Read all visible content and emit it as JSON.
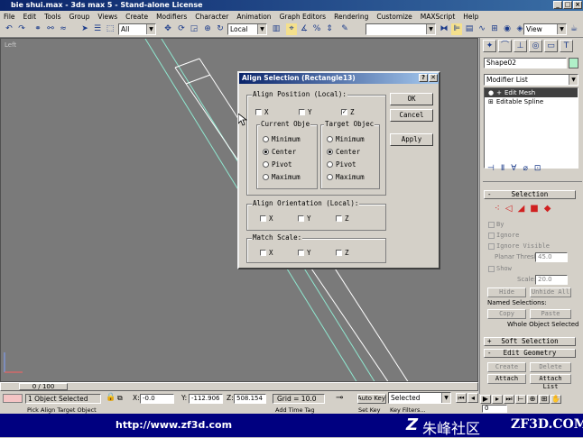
{
  "window": {
    "title": "bie shui.max - 3ds max 5 - Stand-alone License"
  },
  "menu": [
    "File",
    "Edit",
    "Tools",
    "Group",
    "Views",
    "Create",
    "Modifiers",
    "Character",
    "Animation",
    "Graph Editors",
    "Rendering",
    "Customize",
    "MAXScript",
    "Help"
  ],
  "toolbar": {
    "selection_filter": "All",
    "coord_system": "Local",
    "named_selection": "",
    "view_dropdown": "View"
  },
  "viewport": {
    "label": "Left"
  },
  "dialog": {
    "title": "Align Selection (Rectangle13)",
    "help_btn": "?",
    "close_btn": "✕",
    "align_position_label": "Align Position (Local):",
    "pos_x": "X",
    "pos_y": "Y",
    "pos_z": "Z",
    "pos_z_checked": true,
    "current_object_label": "Current Obje",
    "target_object_label": "Target Objec",
    "current_options": [
      "Minimum",
      "Center",
      "Pivot",
      "Maximum"
    ],
    "current_selected": 1,
    "target_options": [
      "Minimum",
      "Center",
      "Pivot",
      "Maximum"
    ],
    "target_selected": 1,
    "align_orientation_label": "Align Orientation (Local):",
    "ori_x": "X",
    "ori_y": "Y",
    "ori_z": "Z",
    "match_scale_label": "Match Scale:",
    "scale_x": "X",
    "scale_y": "Y",
    "scale_z": "Z",
    "ok": "OK",
    "cancel": "Cancel",
    "apply": "Apply"
  },
  "command_panel": {
    "object_name": "Shape02",
    "modifier_list": "Modifier List",
    "stack": [
      "Edit Mesh",
      "Editable Spline"
    ],
    "selection_rollout": "Selection",
    "by": "By",
    "ignore": "Ignore",
    "ignore_visible": "Ignore Visible",
    "planar_thresh_label": "Planar Thresh:",
    "planar_thresh": "45.0",
    "show": "Show",
    "scale_label": "Scale:",
    "scale": "20.0",
    "hide": "Hide",
    "unhide_all": "Unhide All",
    "named_selections": "Named Selections:",
    "copy": "Copy",
    "paste": "Paste",
    "whole_object_selected": "Whole Object Selected",
    "soft_selection": "Soft Selection",
    "edit_geometry": "Edit Geometry",
    "create": "Create",
    "delete": "Delete",
    "attach": "Attach",
    "attach_list": "Attach List"
  },
  "status": {
    "time_slider": "0 / 100",
    "selection_count": "1 Object Selected",
    "x_label": "X:",
    "x_value": "-0.0",
    "y_label": "Y:",
    "y_value": "-112.906",
    "z_label": "Z:",
    "z_value": "508.154",
    "grid": "Grid = 10.0",
    "auto_key": "Auto Key",
    "set_key": "Set Key",
    "key_selected": "Selected",
    "key_filters": "Key Filters...",
    "frame": "0",
    "prompt": "Pick Align Target Object",
    "add_time_tag": "Add Time Tag"
  },
  "banner": {
    "url": "http://www.zf3d.com",
    "brand_cn": "朱峰社区",
    "brand_en": "ZF3D.COM"
  },
  "colors": {
    "title_blue": "#0a246a",
    "viewport_gray": "#7a7a7a",
    "banner_navy": "#000080"
  }
}
